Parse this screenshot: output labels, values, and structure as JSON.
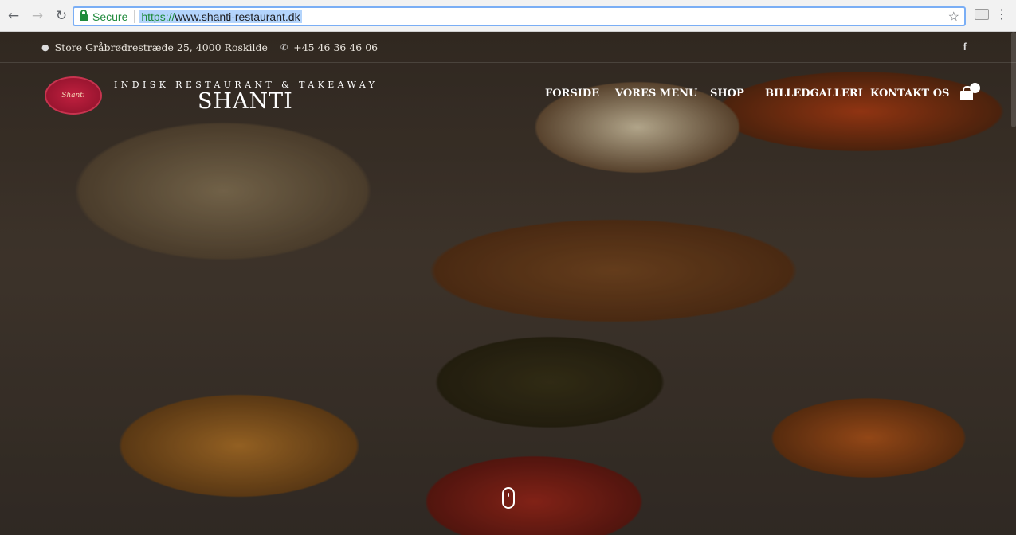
{
  "browser": {
    "secure_label": "Secure",
    "url_protocol": "https://",
    "url_rest": "www.shanti-restaurant.dk"
  },
  "topbar": {
    "address": "Store Gråbrødrestræde 25, 4000 Roskilde",
    "phone": "+45 46 36 46 06",
    "social_icon": "f"
  },
  "header": {
    "logo_text": "Shanti",
    "tagline": "INDISK RESTAURANT & TAKEAWAY",
    "brand": "SHANTI"
  },
  "nav": {
    "items": [
      "FORSIDE",
      "VORES MENU",
      "SHOP",
      "BILLEDGALLERI",
      "KONTAKT OS"
    ]
  },
  "colors": {
    "logo_red": "#9b1530",
    "secure_green": "#1f8a3b",
    "url_highlight": "#b3d4fc"
  }
}
